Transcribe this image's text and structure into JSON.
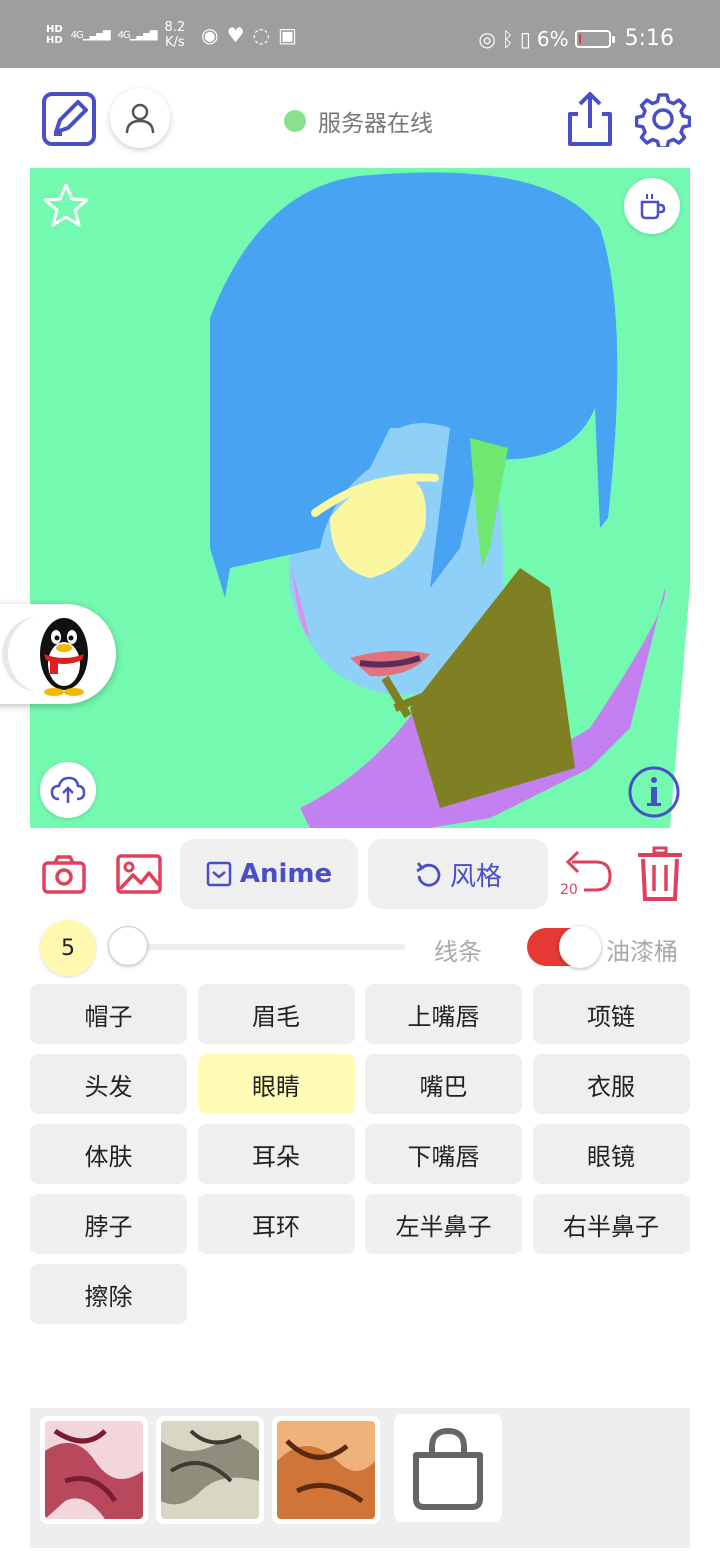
{
  "status_bar": {
    "hd_top": "HD",
    "hd_bottom": "HD",
    "network_1": "4G",
    "network_2": "4G",
    "speed_value": "8.2",
    "speed_unit": "K/s",
    "battery_percent": "6%",
    "battery_level": 0.06,
    "time": "5:16"
  },
  "header": {
    "server_status": "服务器在线",
    "server_status_color": "#8be08b"
  },
  "colors": {
    "accent": "#4b4fc7",
    "danger": "#e53935",
    "canvas_bg": "#74f9b0",
    "active_cell": "#fffcb8"
  },
  "toolbar": {
    "anime_label": "Anime",
    "style_label": "风格",
    "undo_count": "20"
  },
  "brush": {
    "size": "5",
    "line_label": "线条",
    "bucket_label": "油漆桶",
    "bucket_enabled": true
  },
  "labels": [
    {
      "text": "帽子",
      "active": false
    },
    {
      "text": "眉毛",
      "active": false
    },
    {
      "text": "上嘴唇",
      "active": false
    },
    {
      "text": "项链",
      "active": false
    },
    {
      "text": "头发",
      "active": false
    },
    {
      "text": "眼睛",
      "active": true
    },
    {
      "text": "嘴巴",
      "active": false
    },
    {
      "text": "衣服",
      "active": false
    },
    {
      "text": "体肤",
      "active": false
    },
    {
      "text": "耳朵",
      "active": false
    },
    {
      "text": "下嘴唇",
      "active": false
    },
    {
      "text": "眼镜",
      "active": false
    },
    {
      "text": "脖子",
      "active": false
    },
    {
      "text": "耳环",
      "active": false
    },
    {
      "text": "左半鼻子",
      "active": false
    },
    {
      "text": "右半鼻子",
      "active": false
    },
    {
      "text": "擦除",
      "active": false
    }
  ],
  "style_thumbs": [
    {
      "name": "style-thumb-red",
      "color": "#b8485c"
    },
    {
      "name": "style-thumb-grey",
      "color": "#8f8e7d"
    },
    {
      "name": "style-thumb-orange",
      "color": "#d07438"
    }
  ],
  "icons": {
    "edit": "edit-icon",
    "profile": "user-icon",
    "share": "share-icon",
    "settings": "gear-icon",
    "favorite": "star-icon",
    "coffee": "coffee-icon",
    "upload": "cloud-upload-icon",
    "info": "info-icon",
    "camera": "camera-icon",
    "gallery": "image-icon",
    "undo": "undo-icon",
    "delete": "trash-icon",
    "shop": "shopping-bag-icon",
    "qq": "qq-penguin-icon"
  }
}
